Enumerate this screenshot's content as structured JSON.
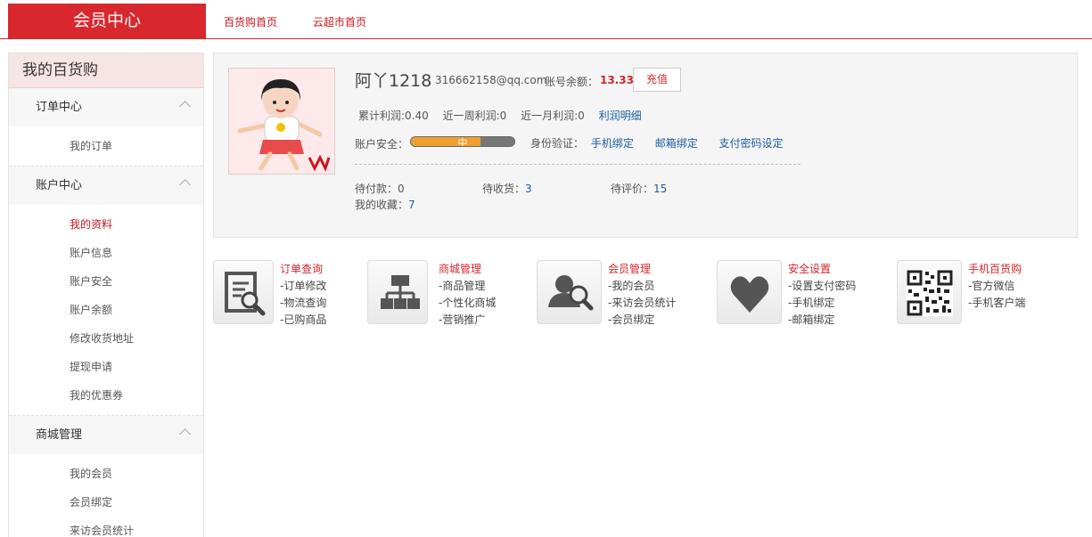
{
  "header": {
    "brand": "会员中心",
    "nav": [
      "百货购首页",
      "云超市首页"
    ]
  },
  "sidebar": {
    "title": "我的百货购",
    "groups": [
      {
        "label": "订单中心",
        "items": [
          "我的订单"
        ]
      },
      {
        "label": "账户中心",
        "items": [
          "我的资料",
          "账户信息",
          "账户安全",
          "账户余额",
          "修改收货地址",
          "提现申请",
          "我的优惠券"
        ]
      },
      {
        "label": "商城管理",
        "items": [
          "我的会员",
          "会员绑定",
          "来访会员统计"
        ]
      }
    ]
  },
  "profile": {
    "username": "阿丫1218",
    "email": "316662158@qq.com",
    "balance_label": "账号余额：",
    "balance": "13.33",
    "recharge": "充值",
    "stats": {
      "total": "累计利润:0.40",
      "week": "近一周利润:0",
      "month": "近一月利润:0",
      "detail_link": "利润明细"
    },
    "security": {
      "label": "账户安全：",
      "level": "中",
      "level_fraction": 0.67,
      "verify_label": "身份验证：",
      "links": [
        "手机绑定",
        "邮箱绑定",
        "支付密码设定"
      ]
    },
    "orders": {
      "pending_pay_label": "待付款：",
      "pending_pay": "0",
      "pending_receive_label": "待收货：",
      "pending_receive": "3",
      "pending_review_label": "待评价：",
      "pending_review": "15",
      "favorites_label": "我的收藏：",
      "favorites": "7"
    }
  },
  "quick_links": [
    {
      "title": "订单查询",
      "lines": [
        "-订单修改",
        "-物流查询",
        "-已购商品"
      ],
      "icon": "document-search-icon"
    },
    {
      "title": "商城管理",
      "lines": [
        "-商品管理",
        "-个性化商城",
        "-营销推广"
      ],
      "icon": "org-chart-icon"
    },
    {
      "title": "会员管理",
      "lines": [
        "-我的会员",
        "-来访会员统计",
        "-会员绑定"
      ],
      "icon": "user-search-icon"
    },
    {
      "title": "安全设置",
      "lines": [
        "-设置支付密码",
        "-手机绑定",
        "-邮箱绑定"
      ],
      "icon": "heart-icon"
    },
    {
      "title": "手机百货购",
      "lines": [
        "-官方微信",
        "-手机客户端"
      ],
      "icon": "qr-code-icon"
    }
  ],
  "colors": {
    "accent": "#d9272e",
    "link": "#1a5c9e"
  }
}
